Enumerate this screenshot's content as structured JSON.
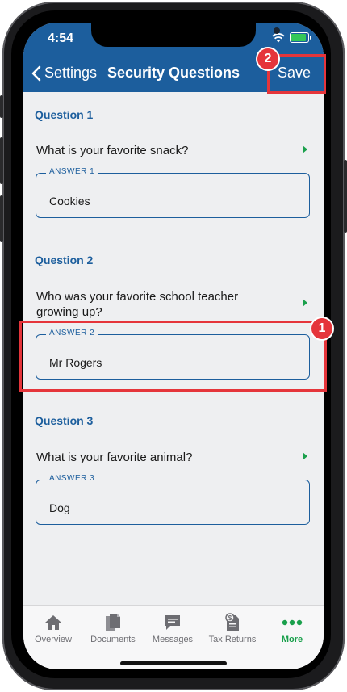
{
  "statusbar": {
    "time": "4:54",
    "battery_color": "#34c759"
  },
  "navbar": {
    "back_label": "Settings",
    "title": "Security Questions",
    "save_label": "Save"
  },
  "questions": [
    {
      "header": "Question 1",
      "text": "What is your favorite snack?",
      "answer_label": "ANSWER 1",
      "answer_value": "Cookies"
    },
    {
      "header": "Question 2",
      "text": "Who was your favorite school teacher growing up?",
      "answer_label": "ANSWER 2",
      "answer_value": "Mr Rogers"
    },
    {
      "header": "Question 3",
      "text": "What is your favorite animal?",
      "answer_label": "ANSWER 3",
      "answer_value": "Dog"
    }
  ],
  "tabbar": {
    "items": [
      {
        "label": "Overview",
        "icon": "home-icon"
      },
      {
        "label": "Documents",
        "icon": "documents-icon"
      },
      {
        "label": "Messages",
        "icon": "message-icon"
      },
      {
        "label": "Tax Returns",
        "icon": "tax-returns-icon"
      },
      {
        "label": "More",
        "icon": "more-icon",
        "active": true
      }
    ],
    "active_color": "#1aa04c"
  },
  "annotations": {
    "badge_1": "1",
    "badge_2": "2",
    "highlight_color": "#e5353b"
  },
  "colors": {
    "brand_blue": "#1c5e9d",
    "background": "#eeeff1"
  }
}
